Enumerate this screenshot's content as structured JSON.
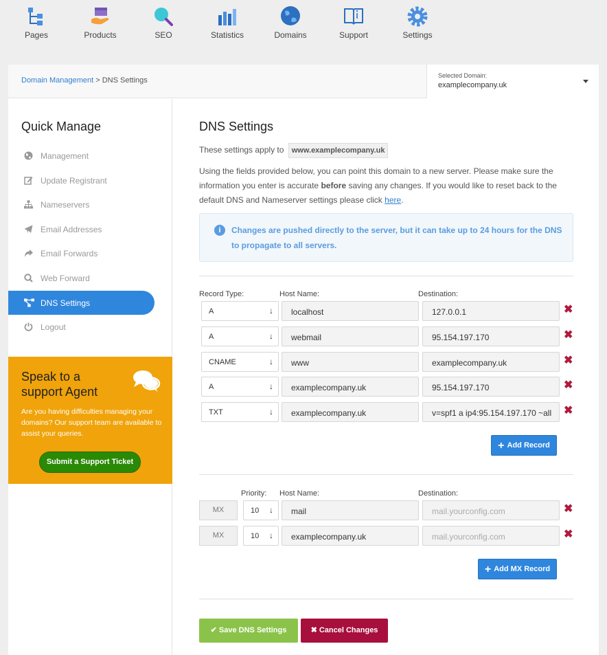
{
  "nav": [
    {
      "label": "Pages",
      "icon": "pages-icon"
    },
    {
      "label": "Products",
      "icon": "products-icon"
    },
    {
      "label": "SEO",
      "icon": "seo-icon"
    },
    {
      "label": "Statistics",
      "icon": "statistics-icon"
    },
    {
      "label": "Domains",
      "icon": "domains-icon"
    },
    {
      "label": "Support",
      "icon": "support-icon"
    },
    {
      "label": "Settings",
      "icon": "settings-icon"
    }
  ],
  "breadcrumb": {
    "parent": "Domain Management",
    "separator": ">",
    "current": "DNS Settings"
  },
  "domain_select": {
    "label": "Selected Domain:",
    "value": "examplecompany.uk"
  },
  "sidebar": {
    "title": "Quick Manage",
    "items": [
      {
        "label": "Management",
        "icon": "globe-icon"
      },
      {
        "label": "Update Registrant",
        "icon": "edit-icon"
      },
      {
        "label": "Nameservers",
        "icon": "sitemap-icon"
      },
      {
        "label": "Email Addresses",
        "icon": "paper-plane-icon"
      },
      {
        "label": "Email Forwards",
        "icon": "share-icon"
      },
      {
        "label": "Web Forward",
        "icon": "search-icon"
      },
      {
        "label": "DNS Settings",
        "icon": "network-icon",
        "active": true
      },
      {
        "label": "Logout",
        "icon": "power-icon"
      }
    ]
  },
  "support_box": {
    "title": "Speak to a support Agent",
    "text": "Are you having difficulties managing your domains? Our support team are available to assist your queries.",
    "button": "Submit a Support Ticket"
  },
  "main": {
    "title": "DNS Settings",
    "applies_prefix": "These settings apply to",
    "applies_domain": "www.examplecompany.uk",
    "desc_1": "Using the fields provided below, you can point this domain to a new server. Please make sure the information you enter is accurate",
    "desc_bold": "before",
    "desc_2": "saving any changes. If you would like to reset back to the default DNS and Nameserver settings please click",
    "desc_link": "here",
    "desc_end": ".",
    "info": "Changes are pushed directly to the server, but it can take up to 24 hours for the DNS to propagate to all servers."
  },
  "records": {
    "headers": {
      "type": "Record Type:",
      "host": "Host Name:",
      "dest": "Destination:"
    },
    "rows": [
      {
        "type": "A",
        "host": "localhost",
        "dest": "127.0.0.1"
      },
      {
        "type": "A",
        "host": "webmail",
        "dest": "95.154.197.170"
      },
      {
        "type": "CNAME",
        "host": "www",
        "dest": "examplecompany.uk"
      },
      {
        "type": "A",
        "host": "examplecompany.uk",
        "dest": "95.154.197.170"
      },
      {
        "type": "TXT",
        "host": "examplecompany.uk",
        "dest": "v=spf1 a ip4:95.154.197.170 ~all"
      }
    ],
    "add_button": "Add Record"
  },
  "mx": {
    "headers": {
      "priority": "Priority:",
      "host": "Host Name:",
      "dest": "Destination:"
    },
    "rows": [
      {
        "tag": "MX",
        "priority": "10",
        "host": "mail",
        "dest_placeholder": "mail.yourconfig.com"
      },
      {
        "tag": "MX",
        "priority": "10",
        "host": "examplecompany.uk",
        "dest_placeholder": "mail.yourconfig.com"
      }
    ],
    "add_button": "Add MX Record"
  },
  "actions": {
    "save": "Save DNS Settings",
    "cancel": "Cancel Changes"
  },
  "symbols": {
    "arrow_down": "↓",
    "delete": "✖",
    "plus": "+",
    "check": "✔",
    "cross": "✖",
    "info": "i"
  },
  "colors": {
    "accent": "#2f86dd",
    "support_bg": "#f0a30a",
    "save": "#8bc34a",
    "cancel": "#a80f3c",
    "delete": "#b01a3a"
  }
}
